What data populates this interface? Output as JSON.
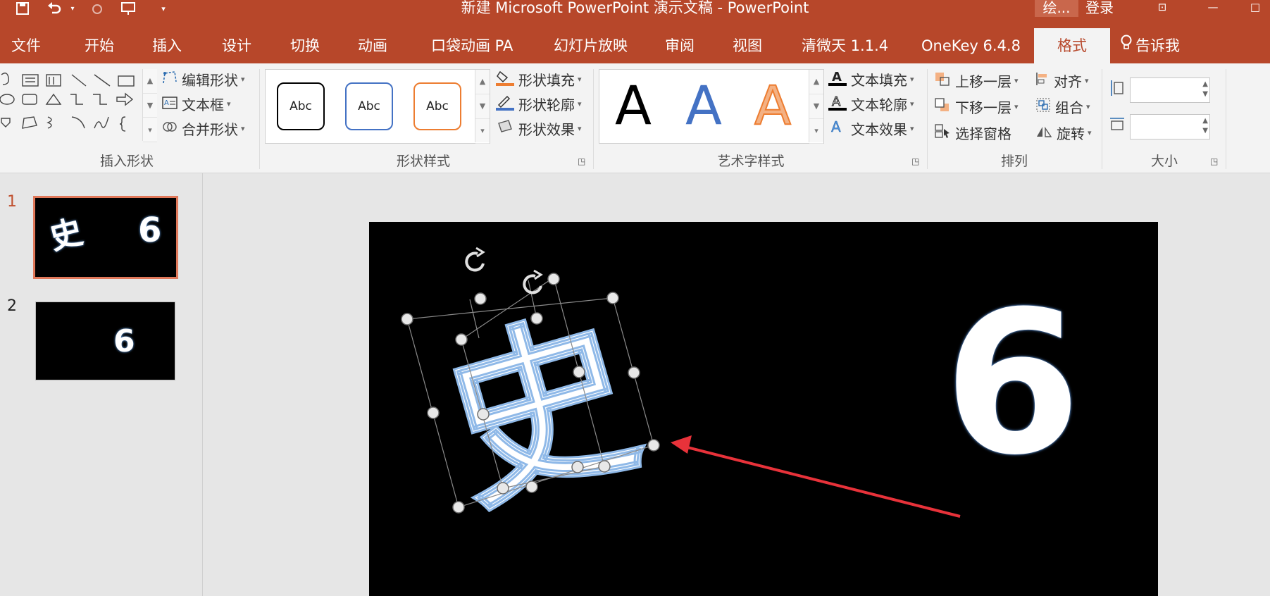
{
  "window": {
    "title": "新建 Microsoft PowerPoint 演示文稿  -  PowerPoint",
    "draw_tab": "绘...",
    "login": "登录"
  },
  "qat": {
    "save_icon": "save-icon",
    "undo_icon": "undo-icon",
    "redo_icon": "redo-icon",
    "present_icon": "present-icon",
    "more_icon": "more-icon"
  },
  "tabs": [
    "文件",
    "开始",
    "插入",
    "设计",
    "切换",
    "动画",
    "口袋动画 PA",
    "幻灯片放映",
    "审阅",
    "视图",
    "清微天 1.1.4",
    "OneKey 6.4.8",
    "格式"
  ],
  "tell_me": "告诉我",
  "ribbon": {
    "insert_shapes": {
      "label": "插入形状",
      "edit_shape": "编辑形状",
      "text_box": "文本框",
      "merge_shapes": "合并形状"
    },
    "shape_styles": {
      "label": "形状样式",
      "abc": [
        "Abc",
        "Abc",
        "Abc"
      ],
      "fill": "形状填充",
      "outline": "形状轮廓",
      "effects": "形状效果"
    },
    "wordart": {
      "label": "艺术字样式",
      "letters": [
        "A",
        "A",
        "A"
      ],
      "fill": "文本填充",
      "outline": "文本轮廓",
      "effects": "文本效果"
    },
    "arrange": {
      "label": "排列",
      "bring_forward": "上移一层",
      "send_backward": "下移一层",
      "selection_pane": "选择窗格",
      "align": "对齐",
      "group": "组合",
      "rotate": "旋转"
    },
    "size": {
      "label": "大小",
      "height": "",
      "width": ""
    }
  },
  "slides": [
    {
      "num": "1",
      "texts": [
        "史",
        "6"
      ]
    },
    {
      "num": "2",
      "texts": [
        "6"
      ]
    }
  ],
  "canvas": {
    "char": "史",
    "number": "6"
  },
  "colors": {
    "accent": "#b7472a",
    "arrow": "#e8323a"
  }
}
